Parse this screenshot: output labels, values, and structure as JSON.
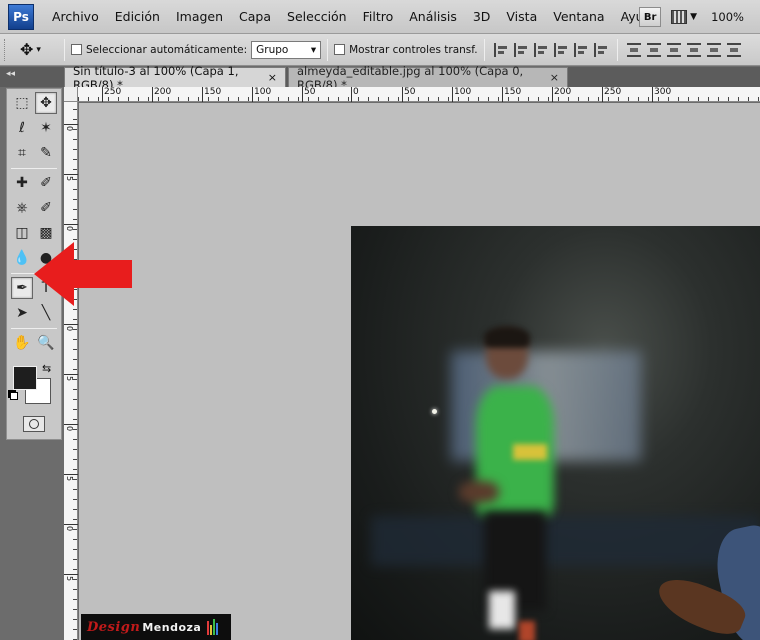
{
  "app": {
    "logo_text": "Ps"
  },
  "menu": [
    "Archivo",
    "Edición",
    "Imagen",
    "Capa",
    "Selección",
    "Filtro",
    "Análisis",
    "3D",
    "Vista",
    "Ventana",
    "Ayuda"
  ],
  "menubar_right": {
    "bridge_label": "Br",
    "zoom_value": "100%",
    "dropdown_glyph": "▼"
  },
  "options_bar": {
    "auto_select_label": "Seleccionar automáticamente:",
    "auto_select_value": "Grupo",
    "show_transform_label": "Mostrar controles transf.",
    "tool_glyph": "✥",
    "dropdown_glyph": "▾"
  },
  "tabs": [
    {
      "label": "Sin título-3 al 100% (Capa 1, RGB/8) *",
      "close": "×"
    },
    {
      "label": "almeyda_editable.jpg al 100% (Capa 0, RGB/8) *",
      "close": "×"
    }
  ],
  "panel": {
    "collapse_glyph": "◂◂"
  },
  "rulers": {
    "h_labels": [
      "250",
      "200",
      "150",
      "100",
      "50",
      "0",
      "50",
      "100",
      "150",
      "200",
      "250",
      "300"
    ],
    "v_labels": [
      "0",
      "5",
      "0",
      "5",
      "0",
      "5",
      "0",
      "5",
      "0",
      "5",
      "0",
      "5"
    ]
  },
  "toolbox": {
    "rows": [
      [
        "⬚",
        "✥"
      ],
      [
        "ℓ",
        "✶"
      ],
      [
        "⌗",
        "✎"
      ],
      [
        "✚",
        "✐"
      ],
      [
        "⎈",
        "✐"
      ],
      [
        "◫",
        "▩"
      ],
      [
        "💧",
        "●"
      ],
      [
        "✒",
        "T"
      ],
      [
        "➤",
        "╲"
      ],
      [
        "✋",
        "🔍"
      ]
    ],
    "swap_glyph": "⇆"
  },
  "watermark": {
    "part1": "Design",
    "part2": "Mendoza"
  },
  "colors": {
    "arrow": "#e81d1d",
    "foreground": "#1e1e1e",
    "background": "#ffffff",
    "canvas_bg": "#bfbfbf",
    "chrome": "#5c5c5c"
  }
}
